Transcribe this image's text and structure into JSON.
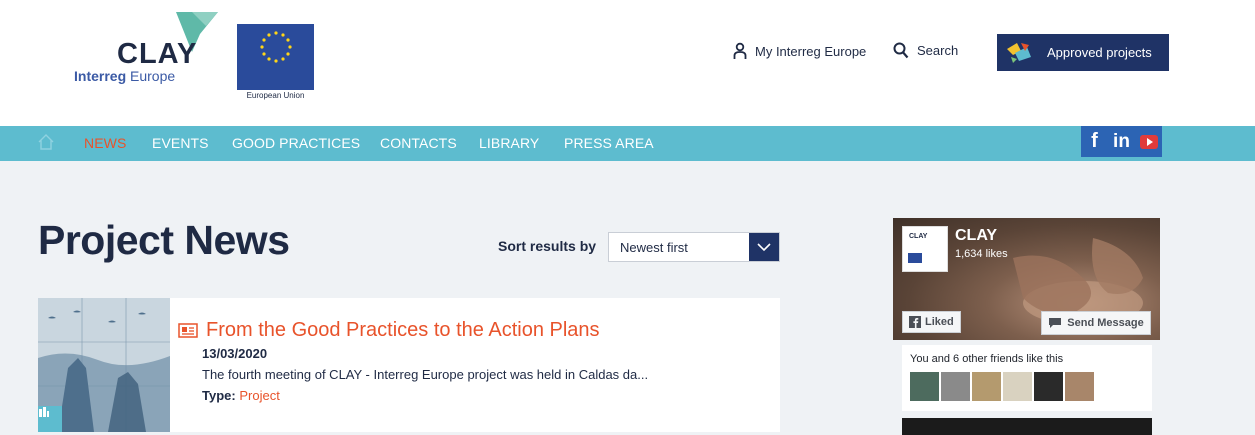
{
  "header": {
    "logo_title": "CLAY",
    "logo_sub_bold": "Interreg",
    "logo_sub_rest": " Europe",
    "eu_caption": "European Union",
    "my_interreg": "My Interreg Europe",
    "search": "Search",
    "approved": "Approved projects"
  },
  "nav": {
    "items": [
      "NEWS",
      "EVENTS",
      "GOOD PRACTICES",
      "CONTACTS",
      "LIBRARY",
      "PRESS AREA"
    ],
    "active": "NEWS",
    "social": [
      "f",
      "in"
    ]
  },
  "main": {
    "title": "Project News",
    "sort_label": "Sort results by",
    "sort_value": "Newest first"
  },
  "news": [
    {
      "title": "From the Good Practices to the Action Plans",
      "date": "13/03/2020",
      "description": "The fourth meeting of CLAY - Interreg Europe project was held in Caldas da...",
      "type_label": "Type:",
      "type_value": "Project"
    }
  ],
  "facebook": {
    "page_name": "CLAY",
    "likes": "1,634 likes",
    "liked_label": "Liked",
    "send_label": "Send Message",
    "friends_text": "You and 6 other friends like this",
    "logo_text": "CLAY"
  },
  "colors": {
    "accent": "#e8532b",
    "nav_bg": "#5dbccf",
    "navy": "#1f3366",
    "page_bg": "#eff2f5"
  }
}
